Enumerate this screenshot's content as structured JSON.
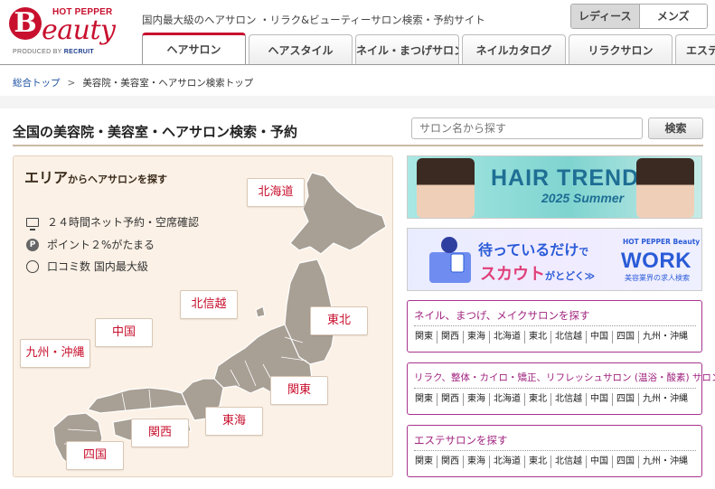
{
  "header": {
    "logo": {
      "hotpepper": "HOT PEPPER",
      "b": "B",
      "beauty": "eauty",
      "produced_by": "PRODUCED BY",
      "recruit": "RECRUIT"
    },
    "tagline": "国内最大級のヘアサロン ・リラク&ビューティーサロン検索・予約サイト",
    "gender": {
      "ladies": "レディース",
      "mens": "メンズ"
    },
    "tabs": [
      "ヘアサロン",
      "ヘアスタイル",
      "ネイル・まつげサロン",
      "ネイルカタログ",
      "リラクサロン",
      "エステ"
    ]
  },
  "breadcrumb": {
    "home": "総合トップ",
    "separator": ">",
    "current": "美容院・美容室・ヘアサロン検索トップ"
  },
  "search": {
    "title": "全国の美容院・美容室・ヘアサロン検索・予約",
    "placeholder": "サロン名から探す",
    "button": "検索"
  },
  "map": {
    "title_big": "エリア",
    "title_rest": "からヘアサロンを探す",
    "features": [
      "２４時間ネット予約・空席確認",
      "ポイント２%がたまる",
      "口コミ数 国内最大級"
    ],
    "regions": {
      "hokkaido": "北海道",
      "tohoku": "東北",
      "hokushinetsu": "北信越",
      "kanto": "関東",
      "tokai": "東海",
      "kansai": "関西",
      "chugoku": "中国",
      "shikoku": "四国",
      "kyushu": "九州・沖縄"
    }
  },
  "banners": {
    "hair_trend": {
      "main": "HAIR TREND",
      "sub": "2025 Summer"
    },
    "work": {
      "line1": "待っているだけ",
      "line1_sm": "で",
      "line2": "スカウト",
      "line2_sm": "がとどく≫",
      "hp": "HOT PEPPER Beauty",
      "big": "WORK",
      "sub": "美容業界の求人検索"
    }
  },
  "categories": [
    {
      "title": "ネイル、まつげ、メイクサロンを探す",
      "links": [
        "関東",
        "関西",
        "東海",
        "北海道",
        "東北",
        "北信越",
        "中国",
        "四国",
        "九州・沖縄"
      ]
    },
    {
      "title": "リラク、整体・カイロ・矯正、リフレッシュサロン (温浴・酸素) サロンを探す",
      "links": [
        "関東",
        "関西",
        "東海",
        "北海道",
        "東北",
        "北信越",
        "中国",
        "四国",
        "九州・沖縄"
      ]
    },
    {
      "title": "エステサロンを探す",
      "links": [
        "関東",
        "関西",
        "東海",
        "北海道",
        "東北",
        "北信越",
        "中国",
        "四国",
        "九州・沖縄"
      ]
    }
  ],
  "colors": {
    "brand": "#c8102e",
    "category": "#a0237e",
    "map_bg": "#fbf1e6",
    "land": "#a89f95"
  }
}
